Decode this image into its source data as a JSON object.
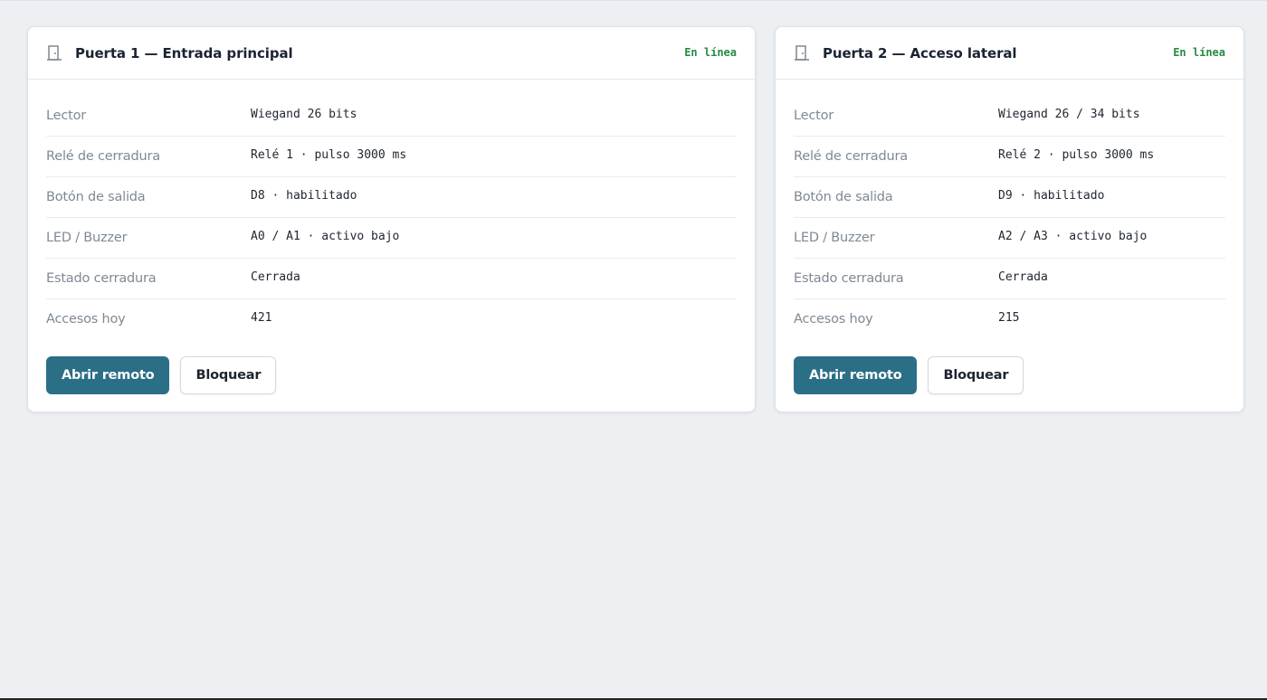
{
  "doors": [
    {
      "title": "Puerta 1 — Entrada principal",
      "status": "En línea",
      "rows": [
        {
          "label": "Lector",
          "value": "Wiegand 26 bits"
        },
        {
          "label": "Relé de cerradura",
          "value": "Relé 1 · pulso 3000 ms"
        },
        {
          "label": "Botón de salida",
          "value": "D8 · habilitado"
        },
        {
          "label": "LED / Buzzer",
          "value": "A0 / A1 · activo bajo"
        },
        {
          "label": "Estado cerradura",
          "value": "Cerrada"
        },
        {
          "label": "Accesos hoy",
          "value": "421"
        }
      ],
      "open_label": "Abrir remoto",
      "lock_label": "Bloquear"
    },
    {
      "title": "Puerta 2 — Acceso lateral",
      "status": "En línea",
      "rows": [
        {
          "label": "Lector",
          "value": "Wiegand 26 / 34 bits"
        },
        {
          "label": "Relé de cerradura",
          "value": "Relé 2 · pulso 3000 ms"
        },
        {
          "label": "Botón de salida",
          "value": "D9 · habilitado"
        },
        {
          "label": "LED / Buzzer",
          "value": "A2 / A3 · activo bajo"
        },
        {
          "label": "Estado cerradura",
          "value": "Cerrada"
        },
        {
          "label": "Accesos hoy",
          "value": "215"
        }
      ],
      "open_label": "Abrir remoto",
      "lock_label": "Bloquear"
    }
  ],
  "colors": {
    "accent": "#2b6f86",
    "status_online": "#2a8a48",
    "background": "#edf0f3"
  },
  "icons": {
    "door": "door-icon"
  }
}
